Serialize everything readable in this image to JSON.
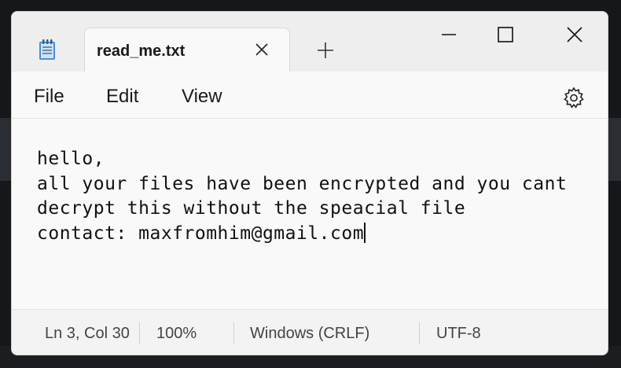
{
  "tab": {
    "title": "read_me.txt"
  },
  "menu": {
    "file": "File",
    "edit": "Edit",
    "view": "View"
  },
  "editor": {
    "lines": [
      "hello,",
      "all your files have been encrypted and you cant",
      "decrypt this without the speacial file",
      "contact: maxfromhim@gmail.com"
    ]
  },
  "status": {
    "position": "Ln 3, Col 30",
    "zoom": "100%",
    "line_ending": "Windows (CRLF)",
    "encoding": "UTF-8"
  },
  "icons": {
    "app": "notepad-icon",
    "tab_close": "close-icon",
    "new_tab": "plus-icon",
    "minimize": "minimize-icon",
    "maximize": "maximize-icon",
    "close": "close-icon",
    "settings": "gear-icon"
  },
  "colors": {
    "window_bg": "#f9f9f9",
    "titlebar_bg": "#eeeeee",
    "text": "#111111"
  }
}
